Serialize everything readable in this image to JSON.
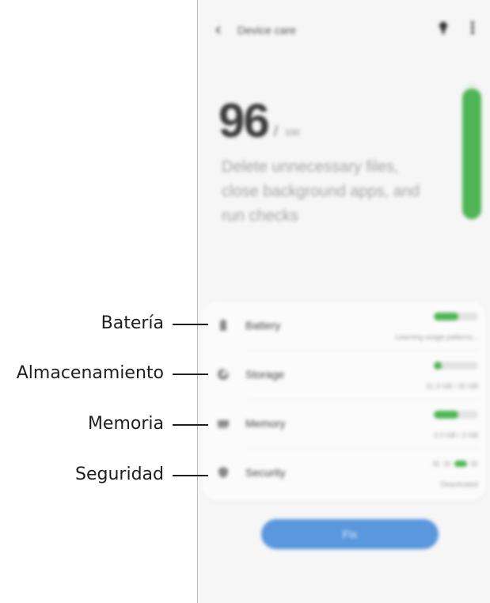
{
  "app": {
    "title": "Device care",
    "score": "96",
    "score_sep": "/",
    "score_max": "100",
    "description": "Delete unnecessary files, close background apps, and run checks",
    "score_fraction": 0.96,
    "fix_label": "Fix"
  },
  "icons": {
    "back": "chevron-left-icon",
    "tips": "lightbulb-icon",
    "more": "more-vert-icon"
  },
  "items": [
    {
      "label": "Battery",
      "status": "Learning usage patterns...",
      "level": 0.55,
      "icon": "battery-icon"
    },
    {
      "label": "Storage",
      "status": "21.3 GB / 32 GB",
      "level": 0.18,
      "icon": "storage-pie-icon"
    },
    {
      "label": "Memory",
      "status": "2.0 GB / 3 GB",
      "level": 0.55,
      "icon": "memory-chip-icon"
    },
    {
      "label": "Security",
      "status": "Deactivated",
      "icon": "shield-icon"
    }
  ],
  "callouts": [
    "Batería",
    "Almacenamiento",
    "Memoria",
    "Seguridad"
  ],
  "colors": {
    "accent_green": "#4fb556",
    "button_blue": "#5b97dc",
    "callout_line": "#1e1e1e"
  }
}
